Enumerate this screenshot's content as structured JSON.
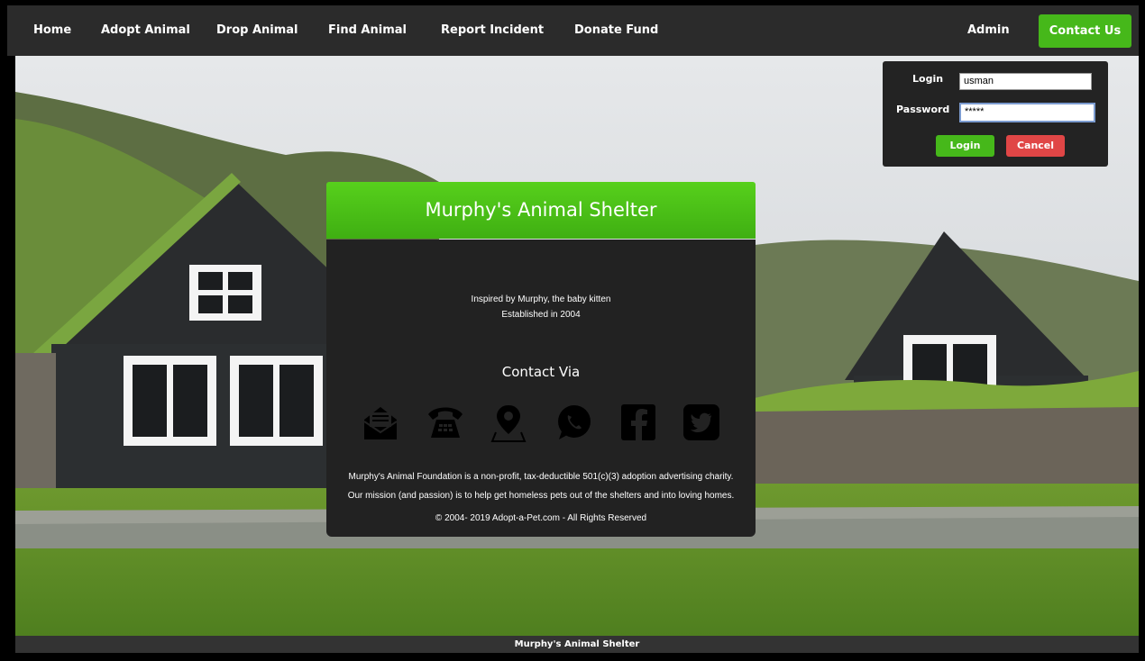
{
  "nav": {
    "items": [
      "Home",
      "Adopt Animal",
      "Drop Animal",
      "Find Animal",
      "Report Incident",
      "Donate Fund"
    ],
    "admin": "Admin",
    "contact": "Contact Us"
  },
  "login": {
    "login_label": "Login",
    "password_label": "Password",
    "username_value": "usman",
    "password_value": "*****",
    "login_button": "Login",
    "cancel_button": "Cancel"
  },
  "card": {
    "title": "Murphy's Animal Shelter",
    "tagline": "Inspired by Murphy, the baby kitten",
    "established": "Established in 2004",
    "contact_via": "Contact Via",
    "contact_icons": [
      "email-icon",
      "telephone-icon",
      "map-pin-icon",
      "whatsapp-icon",
      "facebook-icon",
      "twitter-icon"
    ],
    "description_1": "Murphy's Animal Foundation is a non-profit, tax-deductible 501(c)(3) adoption advertising charity.",
    "description_2": "Our mission (and passion) is to help get homeless pets out of the shelters and into loving homes.",
    "copyright": "© 2004- 2019 Adopt-a-Pet.com - All Rights Reserved"
  },
  "footer": {
    "text": "Murphy's Animal Shelter"
  },
  "colors": {
    "nav_bg": "#2b2b2b",
    "accent_green": "#46b81a",
    "cancel_red": "#e04646",
    "card_bg": "#222222"
  }
}
